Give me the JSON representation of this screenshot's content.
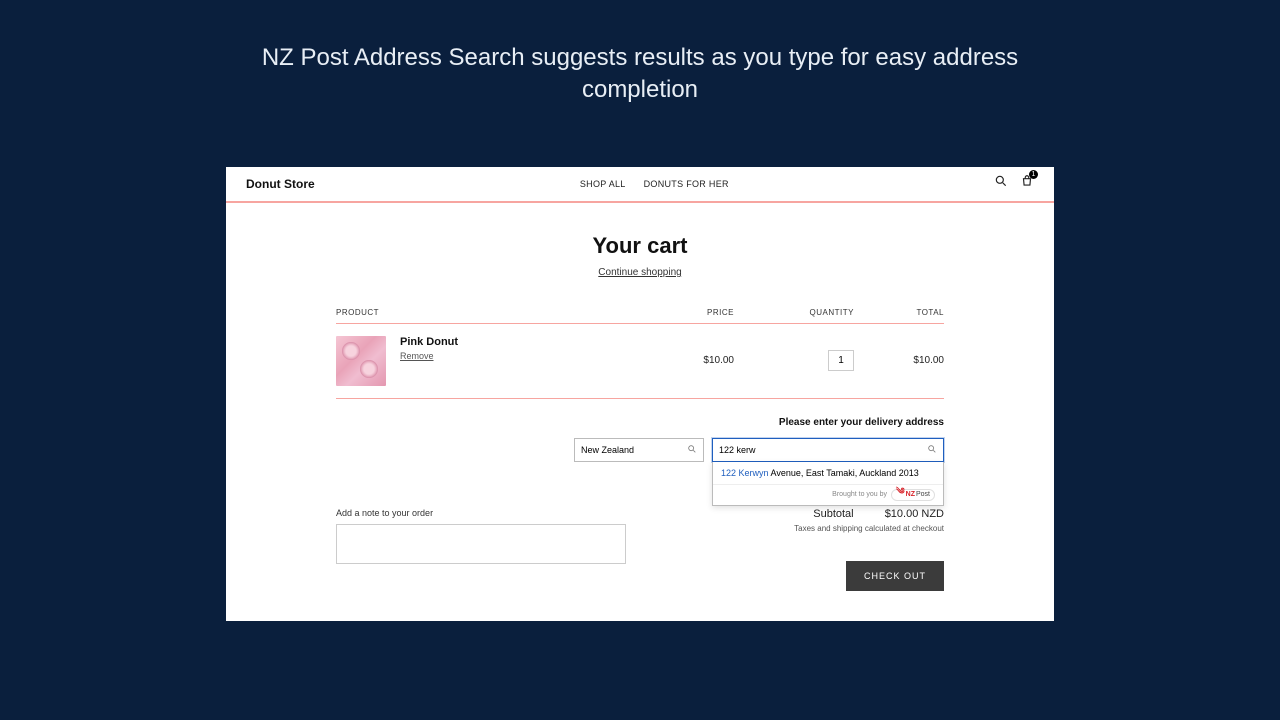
{
  "caption": "NZ Post Address Search suggests results as you type for easy address completion",
  "header": {
    "store_name": "Donut Store",
    "nav": [
      "SHOP ALL",
      "DONUTS FOR HER"
    ],
    "cart_count": "1"
  },
  "cart": {
    "title": "Your cart",
    "continue_label": "Continue shopping",
    "columns": {
      "product": "PRODUCT",
      "price": "PRICE",
      "quantity": "QUANTITY",
      "total": "TOTAL"
    },
    "items": [
      {
        "name": "Pink Donut",
        "remove_label": "Remove",
        "price": "$10.00",
        "quantity": "1",
        "line_total": "$10.00"
      }
    ]
  },
  "delivery": {
    "prompt": "Please enter your delivery address",
    "country": "New Zealand",
    "query": "122 kerw",
    "suggestion_highlight": "122 Kerwyn",
    "suggestion_rest": " Avenue, East Tamaki, Auckland 2013",
    "brought_by": "Brought to you by",
    "brand_nz": "NZ",
    "brand_post": "Post"
  },
  "note": {
    "label": "Add a note to your order"
  },
  "summary": {
    "subtotal_label": "Subtotal",
    "subtotal_value": "$10.00 NZD",
    "tax_note": "Taxes and shipping calculated at checkout",
    "checkout_label": "CHECK OUT"
  }
}
